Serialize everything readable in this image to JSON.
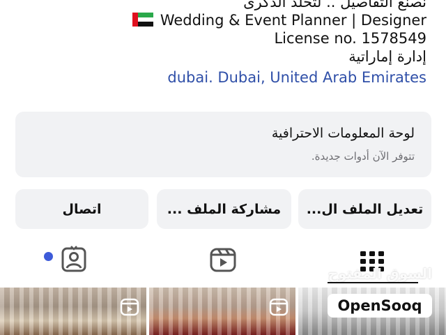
{
  "profile": {
    "tagline": "نصنع التفاصيل .. لتخلد الذكرى",
    "title_line": "Wedding & Event Planner | Designer",
    "license": "License no. 1578549",
    "admin": "إدارة إماراتية",
    "location": "dubai. Dubai, United Arab Emirates",
    "flag_icon": "uae-flag-icon"
  },
  "dashboard": {
    "title": "لوحة المعلومات الاحترافية",
    "subtitle": "تتوفر الآن أدوات جديدة.",
    "dot_color": "#3d5bd9"
  },
  "actions": {
    "edit_profile": "تعديل الملف ال...",
    "share_profile": "مشاركة الملف ...",
    "contact": "اتصال"
  },
  "tabs": [
    {
      "name": "grid",
      "icon": "grid-icon",
      "selected": true
    },
    {
      "name": "reels",
      "icon": "reels-icon",
      "selected": false
    },
    {
      "name": "tagged",
      "icon": "tagged-icon",
      "selected": false
    }
  ],
  "watermark": {
    "arabic": "السوق المفتوح",
    "brand": "OpenSooq"
  },
  "colors": {
    "link": "#2f4fa8",
    "button_bg": "#f1f2f4",
    "accent_dot": "#3d5bd9"
  }
}
